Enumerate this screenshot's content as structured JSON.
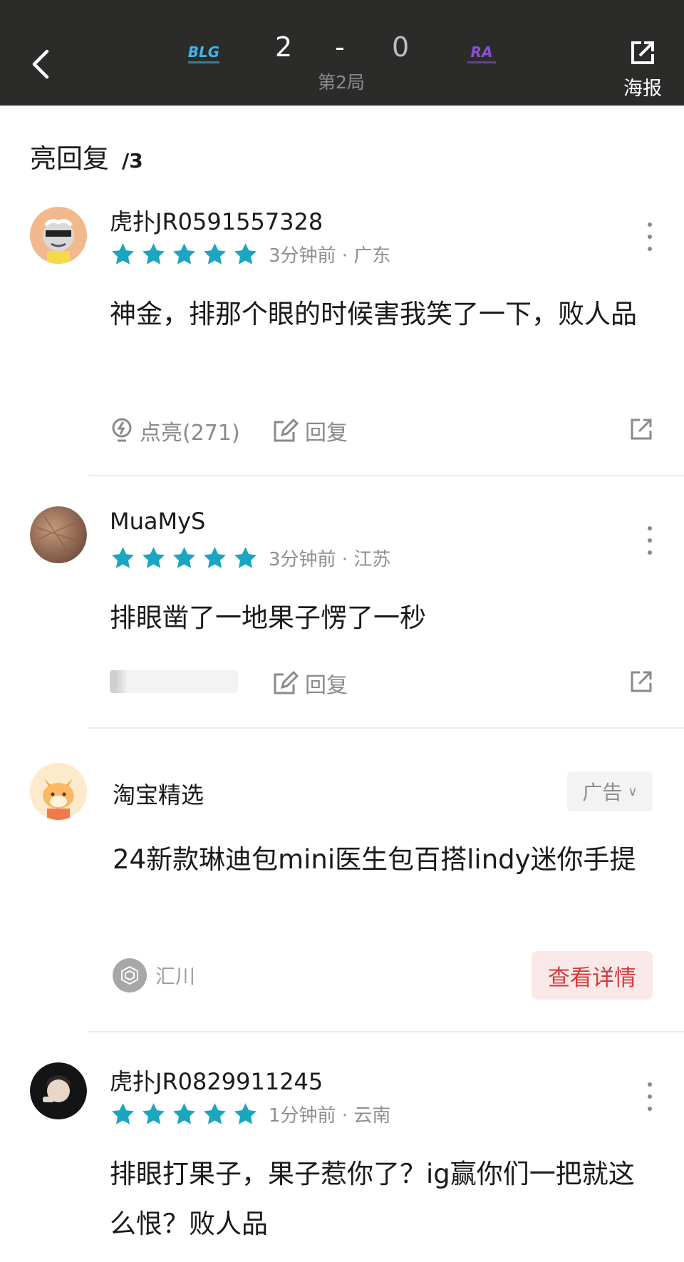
{
  "header": {
    "home_team": "BLG",
    "away_team": "RA",
    "home_score": "2",
    "dash": "-",
    "away_score": "0",
    "game_label": "第2局",
    "poster_label": "海报",
    "icons": {
      "back": "chevron-left-icon",
      "poster": "share-external-icon"
    }
  },
  "section": {
    "title": "亮回复",
    "count": "/3"
  },
  "comments": [
    {
      "username": "虎扑JR0591557328",
      "stars": 5,
      "meta": "3分钟前 · 广东",
      "text": "神金，排那个眼的时候害我笑了一下，败人品",
      "like_label": "点亮(271)",
      "reply_label": "回复"
    },
    {
      "username": "MuaMyS",
      "stars": 5,
      "meta": "3分钟前 · 江苏",
      "text": "排眼凿了一地果子愣了一秒",
      "reply_label": "回复"
    },
    {
      "username": "虎扑JR0829911245",
      "stars": 5,
      "meta": "1分钟前 · 云南",
      "text": "排眼打果子，果子惹你了？ig赢你们一把就这么恨？败人品"
    }
  ],
  "ad": {
    "name": "淘宝精选",
    "badge": "广告",
    "text": "24新款琳迪包mini医生包百搭lindy迷你手提",
    "brand": "汇川",
    "detail_button": "查看详情"
  },
  "colors": {
    "header_bg": "#2b2c2a",
    "star": "#1aa6c1",
    "detail_btn_bg": "#fbe9e9",
    "detail_btn_text": "#d63a3a"
  }
}
